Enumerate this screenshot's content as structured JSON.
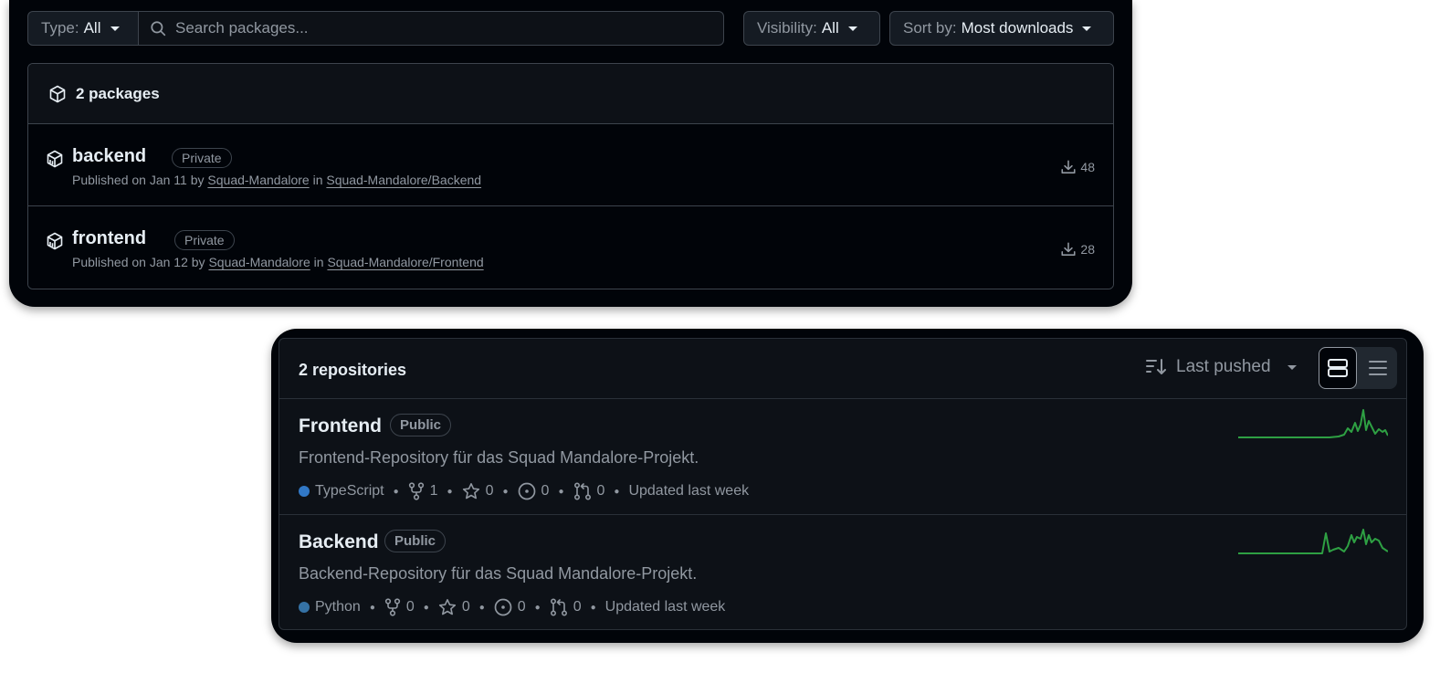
{
  "packages_panel": {
    "type_filter": {
      "label": "Type:",
      "value": "All"
    },
    "search": {
      "placeholder": "Search packages..."
    },
    "visibility_filter": {
      "label": "Visibility:",
      "value": "All"
    },
    "sort_filter": {
      "label": "Sort by:",
      "value": "Most downloads"
    },
    "header": "2 packages",
    "items": [
      {
        "name": "backend",
        "badge": "Private",
        "published": "Published on Jan 11 by",
        "owner": "Squad-Mandalore",
        "in": "in",
        "repo": "Squad-Mandalore/Backend",
        "downloads": "48"
      },
      {
        "name": "frontend",
        "badge": "Private",
        "published": "Published on Jan 12 by",
        "owner": "Squad-Mandalore",
        "in": "in",
        "repo": "Squad-Mandalore/Frontend",
        "downloads": "28"
      }
    ]
  },
  "repos_panel": {
    "count": "2 repositories",
    "sort_label": "Last pushed",
    "items": [
      {
        "name": "Frontend",
        "badge": "Public",
        "description": "Frontend-Repository für das Squad Mandalore-Projekt.",
        "language": "TypeScript",
        "lang_color": "#3178c6",
        "forks": "1",
        "stars": "0",
        "issues": "0",
        "pulls": "0",
        "updated": "Updated last week"
      },
      {
        "name": "Backend",
        "badge": "Public",
        "description": "Backend-Repository für das Squad Mandalore-Projekt.",
        "language": "Python",
        "lang_color": "#3572A5",
        "forks": "0",
        "stars": "0",
        "issues": "0",
        "pulls": "0",
        "updated": "Updated last week"
      }
    ]
  },
  "colors": {
    "sparkline": "#2ea043",
    "panel_bg": "#010409",
    "border": "#3d444d"
  }
}
